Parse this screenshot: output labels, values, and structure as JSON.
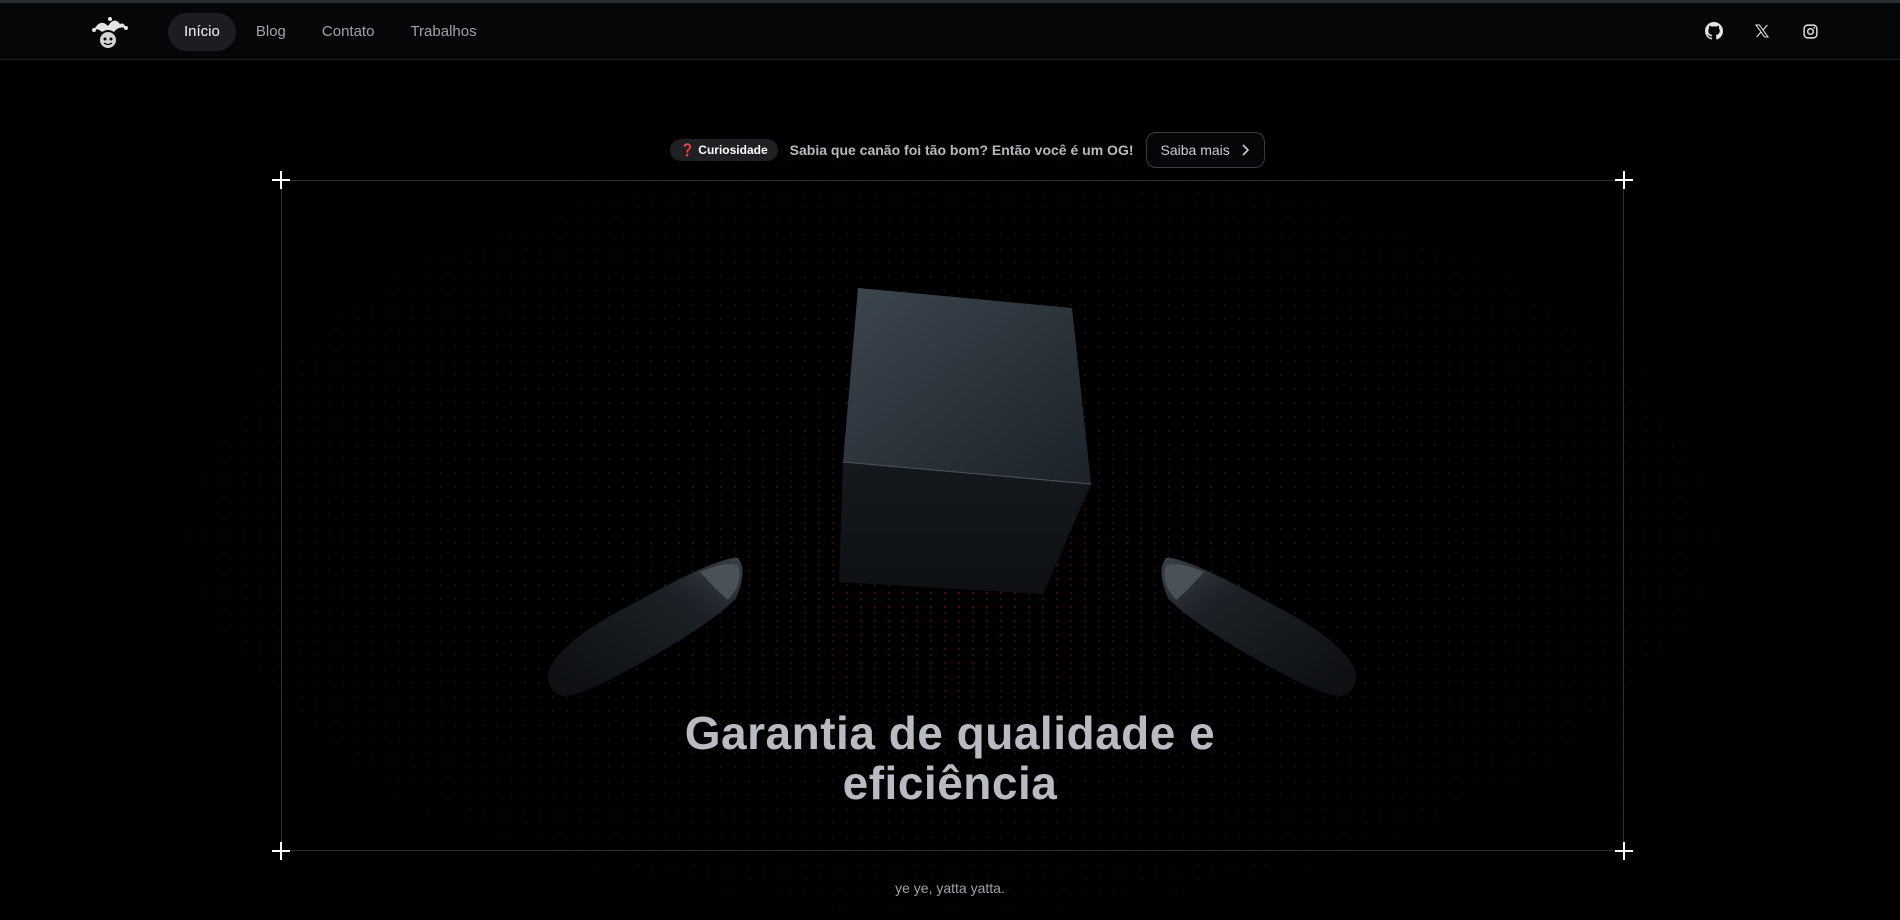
{
  "nav": {
    "items": [
      {
        "label": "Início",
        "active": true
      },
      {
        "label": "Blog",
        "active": false
      },
      {
        "label": "Contato",
        "active": false
      },
      {
        "label": "Trabalhos",
        "active": false
      }
    ]
  },
  "socials": [
    "github-icon",
    "x-icon",
    "instagram-icon"
  ],
  "announcement": {
    "badge_icon": "❓",
    "badge_label": "Curiosidade",
    "text": "Sabia que canão foi tão bom? Então você é um OG!",
    "button_label": "Saiba mais"
  },
  "hero": {
    "headline_line1": "Garantia de qualidade e",
    "headline_line2": "eficiência",
    "subtitle": "ye ye, yatta yatta."
  },
  "colors": {
    "background": "#000000",
    "accent_red": "#ef4444",
    "text_muted": "#a1a1aa"
  }
}
